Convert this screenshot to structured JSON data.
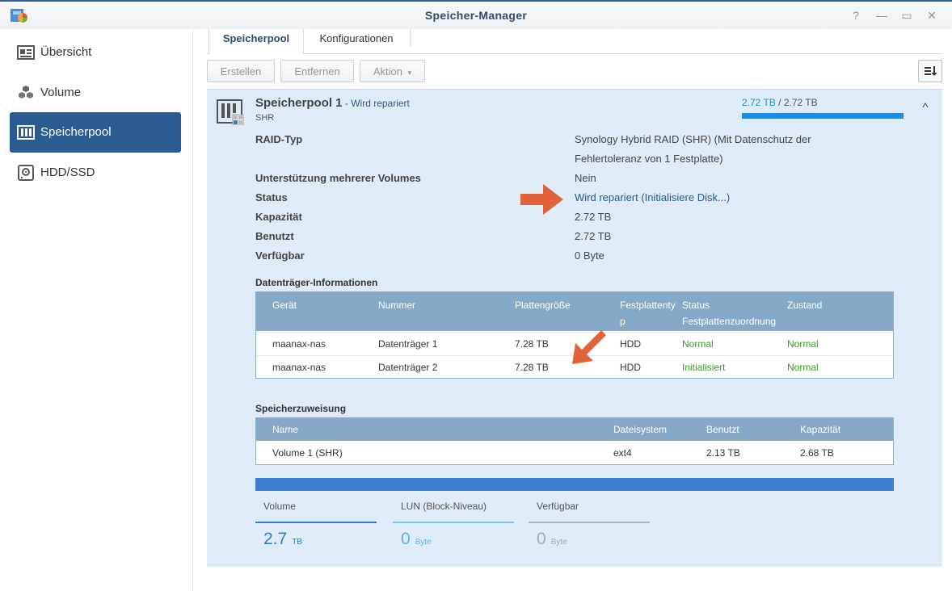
{
  "window": {
    "title": "Speicher-Manager",
    "controls": {
      "help": "?",
      "minimize": "—",
      "maximize": "▭",
      "close": "✕"
    }
  },
  "sidebar": {
    "items": [
      {
        "label": "Übersicht",
        "icon": "overview-icon",
        "active": false
      },
      {
        "label": "Volume",
        "icon": "volume-cubes-icon",
        "active": false
      },
      {
        "label": "Speicherpool",
        "icon": "storage-pool-icon",
        "active": true
      },
      {
        "label": "HDD/SSD",
        "icon": "hdd-icon",
        "active": false
      }
    ]
  },
  "tabs": [
    {
      "label": "Speicherpool",
      "active": true
    },
    {
      "label": "Konfigurationen",
      "active": false
    }
  ],
  "toolbar": {
    "create": "Erstellen",
    "remove": "Entfernen",
    "action": "Aktion",
    "action_caret": "▾"
  },
  "pool": {
    "name": "Speicherpool 1",
    "separator": " - ",
    "status_short": "Wird repariert",
    "type_short": "SHR",
    "usage_used": "2.72 TB",
    "usage_sep": " / ",
    "usage_total": "2.72 TB",
    "usage_fraction": 1.0,
    "collapse_icon": "^"
  },
  "properties": [
    {
      "label": "RAID-Typ",
      "value": "Synology Hybrid RAID (SHR) (Mit Datenschutz der Fehlertoleranz von 1 Festplatte)"
    },
    {
      "label": "Unterstützung mehrerer Volumes",
      "value": "Nein"
    },
    {
      "label": "Status",
      "value": "Wird repariert (Initialisiere Disk...)"
    },
    {
      "label": "Kapazität",
      "value": "2.72 TB"
    },
    {
      "label": "Benutzt",
      "value": "2.72 TB"
    },
    {
      "label": "Verfügbar",
      "value": "0 Byte"
    }
  ],
  "disk_info": {
    "title": "Datenträger-Informationen",
    "headers": [
      "Gerät",
      "Nummer",
      "Plattengröße",
      "Festplattenty p",
      "Status Festplattenzuordnung",
      "Zustand"
    ],
    "rows": [
      [
        "maanax-nas",
        "Datenträger 1",
        "7.28 TB",
        "HDD",
        "Normal",
        "Normal"
      ],
      [
        "maanax-nas",
        "Datenträger 2",
        "7.28 TB",
        "HDD",
        "Initialisiert",
        "Normal"
      ]
    ]
  },
  "allocation": {
    "title": "Speicherzuweisung",
    "headers": [
      "Name",
      "Dateisystem",
      "Benutzt",
      "Kapazität"
    ],
    "rows": [
      [
        "Volume 1 (SHR)",
        "ext4",
        "2.13 TB",
        "2.68 TB"
      ]
    ]
  },
  "summary": {
    "stats": [
      {
        "label": "Volume",
        "value": "2.7",
        "unit": "TB",
        "color": "#2f7fc6",
        "line": "#2f7fc6"
      },
      {
        "label": "LUN (Block-Niveau)",
        "value": "0",
        "unit": "Byte",
        "color": "#5fb2ea",
        "line": "#7cc0ee"
      },
      {
        "label": "Verfügbar",
        "value": "0",
        "unit": "Byte",
        "color": "#a3aab1",
        "line": "#b0b6bc"
      }
    ]
  },
  "colors": {
    "accent": "#2a5c92",
    "panel_bg": "#dfebf7",
    "table_header": "#85a9c7",
    "annotation_arrow": "#e0623a",
    "status_green": "#3a9a2a"
  }
}
